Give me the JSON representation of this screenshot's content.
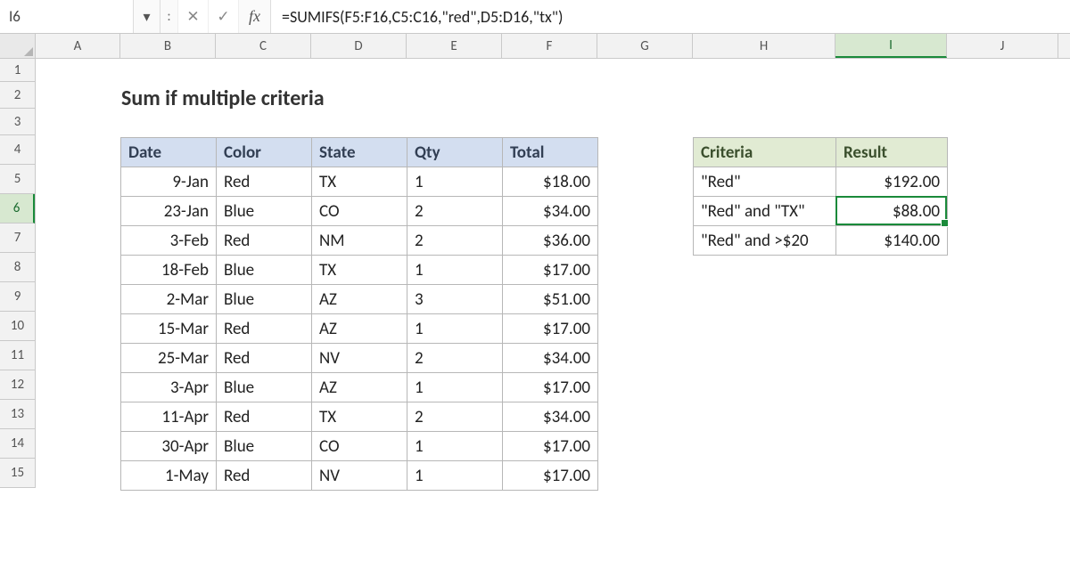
{
  "namebox": {
    "ref": "I6"
  },
  "toolbarSep": ":",
  "icons": {
    "cancel": "✕",
    "enter": "✓",
    "chevron": "▾"
  },
  "fx": "fx",
  "formula": "=SUMIFS(F5:F16,C5:C16,\"red\",D5:D16,\"tx\")",
  "columns": [
    "A",
    "B",
    "C",
    "D",
    "E",
    "F",
    "G",
    "H",
    "I",
    "J"
  ],
  "columnWidths": [
    "cw-A",
    "cw-B",
    "cw-C",
    "cw-D",
    "cw-E",
    "cw-F",
    "cw-G",
    "cw-H",
    "cw-I",
    "cw-J"
  ],
  "activeColumnIndex": 8,
  "rows": [
    1,
    2,
    3,
    4,
    5,
    6,
    7,
    8,
    9,
    10,
    11,
    12,
    13,
    14,
    15
  ],
  "activeRowNumber": 6,
  "title": "Sum if multiple criteria",
  "mainHeaders": [
    "Date",
    "Color",
    "State",
    "Qty",
    "Total"
  ],
  "mainRows": [
    {
      "date": "9-Jan",
      "color": "Red",
      "state": "TX",
      "qty": "1",
      "total": "$18.00"
    },
    {
      "date": "23-Jan",
      "color": "Blue",
      "state": "CO",
      "qty": "2",
      "total": "$34.00"
    },
    {
      "date": "3-Feb",
      "color": "Red",
      "state": "NM",
      "qty": "2",
      "total": "$36.00"
    },
    {
      "date": "18-Feb",
      "color": "Blue",
      "state": "TX",
      "qty": "1",
      "total": "$17.00"
    },
    {
      "date": "2-Mar",
      "color": "Blue",
      "state": "AZ",
      "qty": "3",
      "total": "$51.00"
    },
    {
      "date": "15-Mar",
      "color": "Red",
      "state": "AZ",
      "qty": "1",
      "total": "$17.00"
    },
    {
      "date": "25-Mar",
      "color": "Red",
      "state": "NV",
      "qty": "2",
      "total": "$34.00"
    },
    {
      "date": "3-Apr",
      "color": "Blue",
      "state": "AZ",
      "qty": "1",
      "total": "$17.00"
    },
    {
      "date": "11-Apr",
      "color": "Red",
      "state": "TX",
      "qty": "2",
      "total": "$34.00"
    },
    {
      "date": "30-Apr",
      "color": "Blue",
      "state": "CO",
      "qty": "1",
      "total": "$17.00"
    },
    {
      "date": "1-May",
      "color": "Red",
      "state": "NV",
      "qty": "1",
      "total": "$17.00"
    }
  ],
  "sideHeaders": [
    "Criteria",
    "Result"
  ],
  "sideRows": [
    {
      "criteria": "\"Red\"",
      "result": "$192.00"
    },
    {
      "criteria": "\"Red\" and \"TX\"",
      "result": "$88.00"
    },
    {
      "criteria": "\"Red\" and >$20",
      "result": "$140.00"
    }
  ],
  "activeCell": {
    "ref": "I6"
  }
}
